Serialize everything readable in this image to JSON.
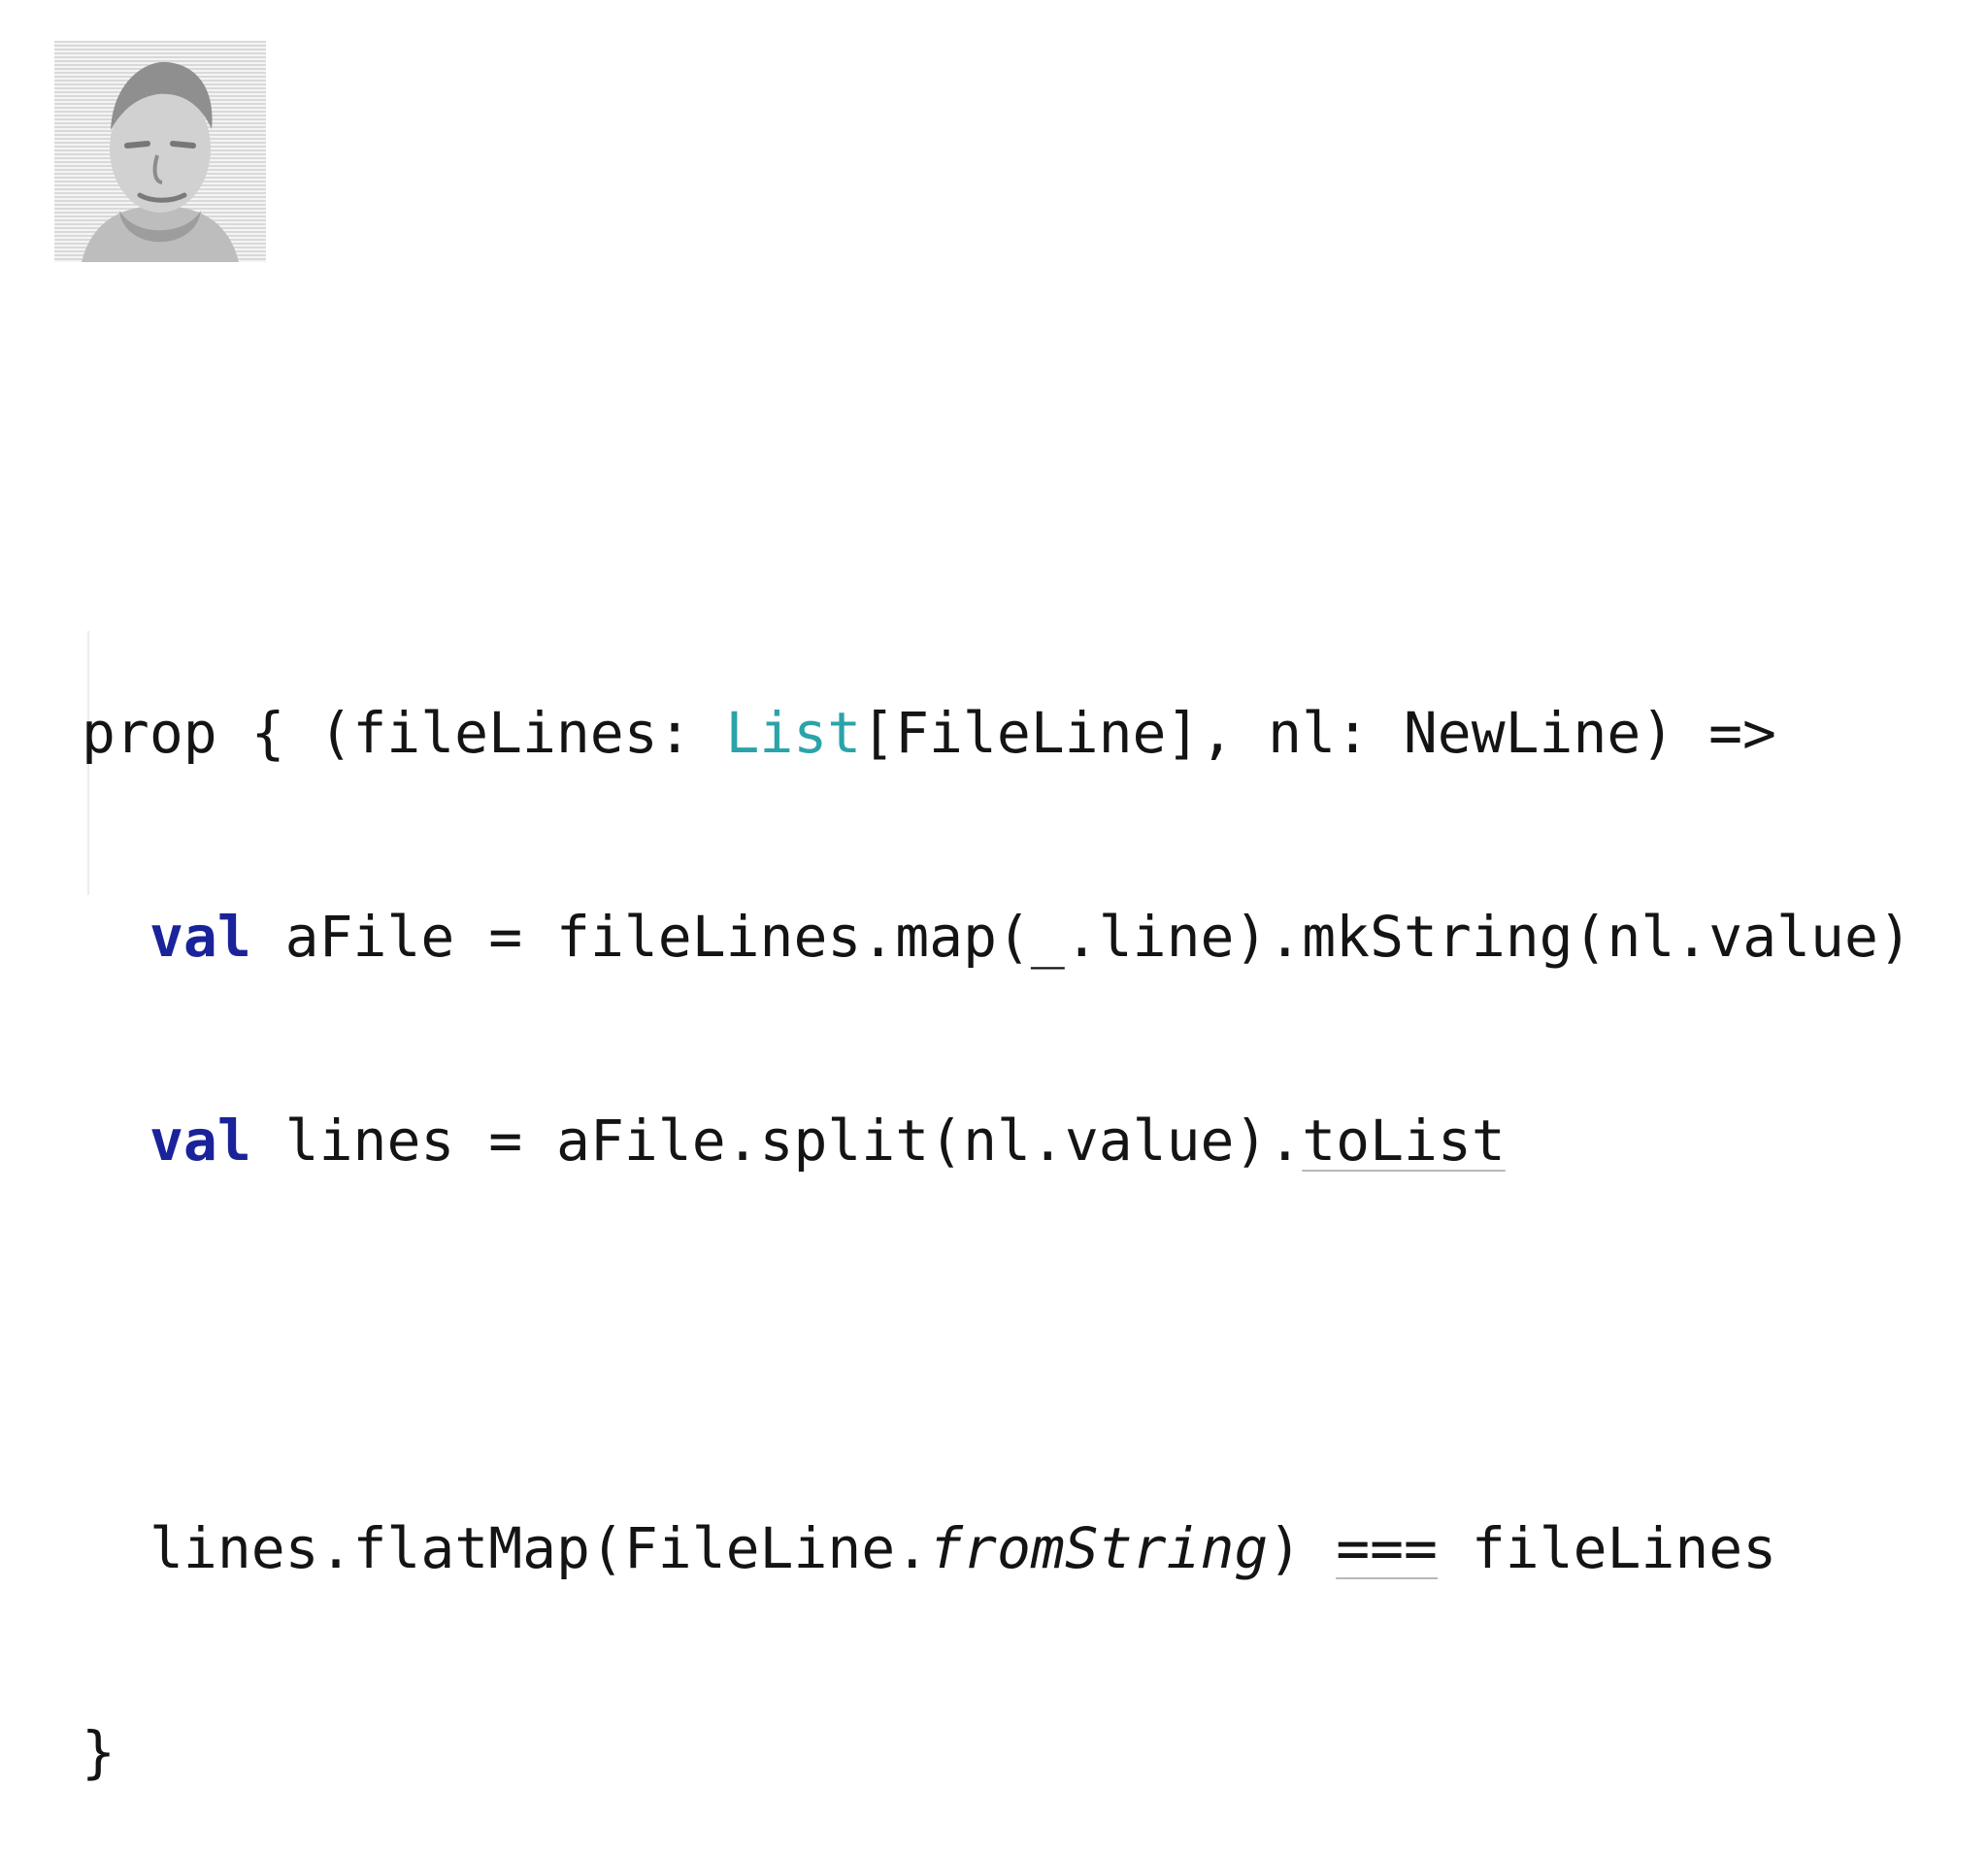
{
  "code": {
    "line1": {
      "prefix": "prop { (fileLines: ",
      "type": "List",
      "suffix": "[FileLine], nl: NewLine) =>"
    },
    "line2": {
      "keyword": "val",
      "rest": " aFile = fileLines.map(_.line).mkString(nl.value)"
    },
    "line3": {
      "keyword": "val",
      "middle": " lines = aFile.split(nl.value).",
      "method": "toList"
    },
    "line5": {
      "prefix": "lines.flatMap(FileLine.",
      "italic": "fromString",
      "middle": ") ",
      "operator": "===",
      "suffix": " fileLines"
    },
    "line6": {
      "text": "}"
    }
  },
  "colors": {
    "keyword": "#1a239a",
    "type": "#2aa4a8",
    "text": "#141414"
  }
}
